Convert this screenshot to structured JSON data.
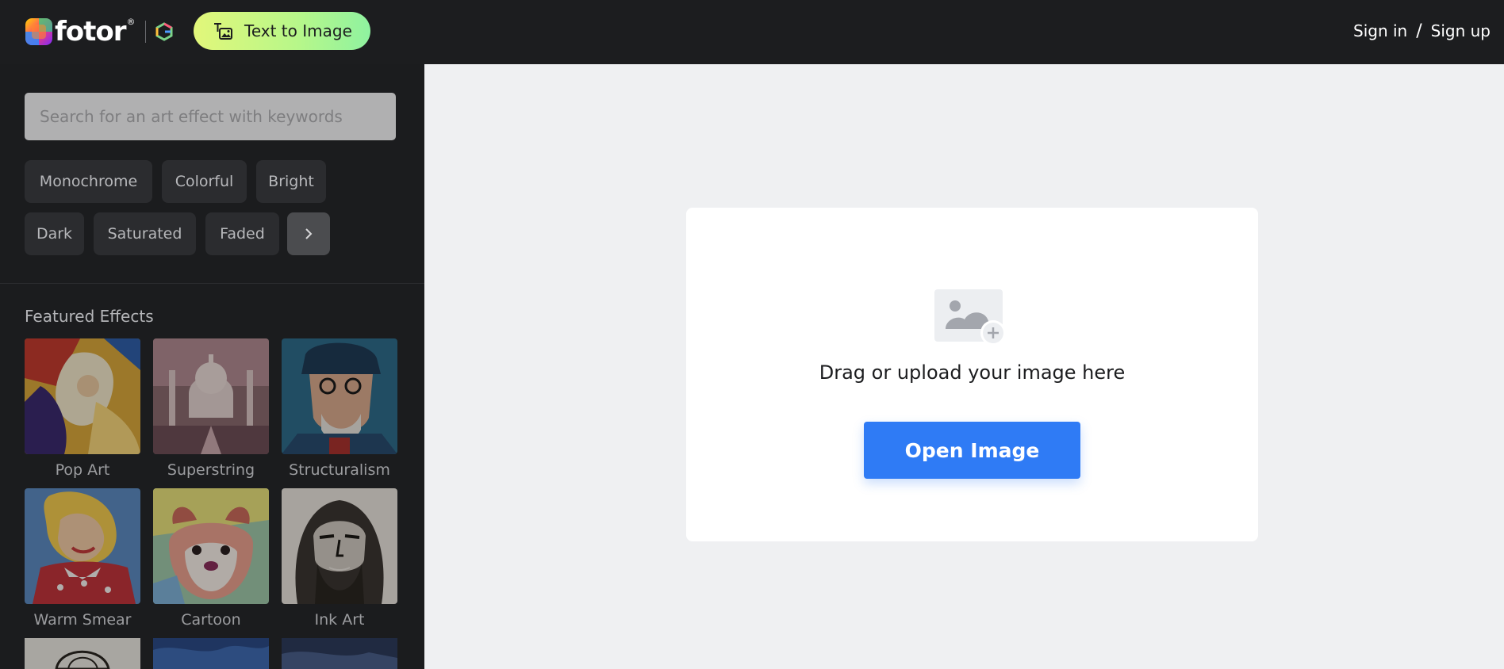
{
  "header": {
    "logo_text": "fotor",
    "logo_registered": "®",
    "text_to_image_label": "Text to Image",
    "sign_in": "Sign in",
    "separator": "/",
    "sign_up": "Sign up"
  },
  "sidebar": {
    "search_placeholder": "Search for an art effect with keywords",
    "filters": [
      "Monochrome",
      "Colorful",
      "Bright",
      "Dark",
      "Saturated",
      "Faded"
    ],
    "filters_more_icon": "chevron-right-icon",
    "featured_title": "Featured Effects",
    "effects": [
      {
        "name": "Pop Art"
      },
      {
        "name": "Superstring"
      },
      {
        "name": "Structuralism"
      },
      {
        "name": "Warm Smear"
      },
      {
        "name": "Cartoon"
      },
      {
        "name": "Ink Art"
      }
    ]
  },
  "main": {
    "upload_icon": "image-add-icon",
    "drop_text": "Drag or upload your image here",
    "open_button": "Open Image"
  },
  "colors": {
    "header_bg": "#1c1d1f",
    "sidebar_bg": "#1b1c1e",
    "main_bg": "#eff0f2",
    "primary_button": "#2f7bf5",
    "tti_gradient_start": "#e2f77a",
    "tti_gradient_end": "#8ff2a0"
  }
}
